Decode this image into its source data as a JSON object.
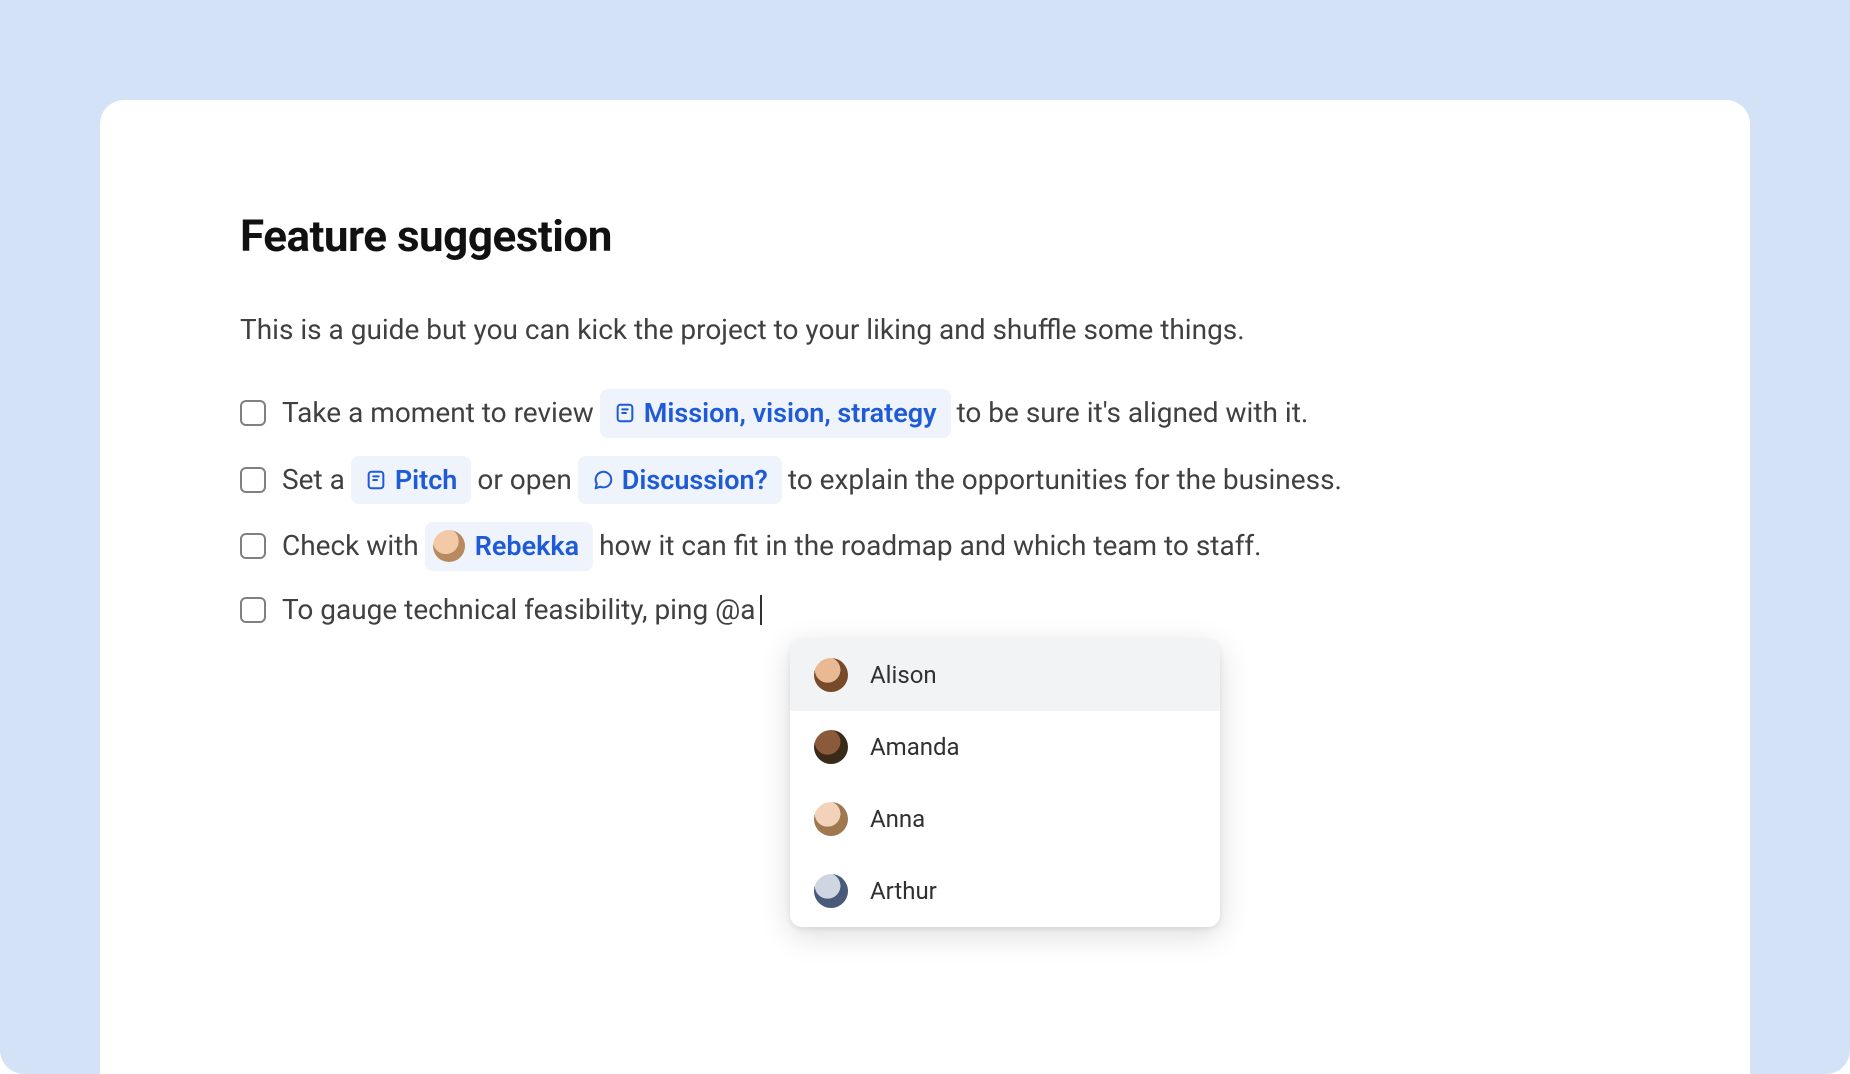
{
  "title": "Feature suggestion",
  "intro": "This is a guide but you can kick the project to your liking and shuffle some things.",
  "tasks": [
    {
      "pre": "Take a moment to review",
      "tag1": "Mission, vision, strategy",
      "post": "to be sure it's aligned with it."
    },
    {
      "pre": "Set a",
      "tag1": "Pitch",
      "mid": "or open",
      "tag2": "Discussion?",
      "post": "to explain the opportunities for the business."
    },
    {
      "pre": "Check with",
      "mention": "Rebekka",
      "post": "how it can fit in the roadmap and which team to staff."
    },
    {
      "pre": "To gauge technical feasibility, ping @a"
    }
  ],
  "mention_popup": {
    "items": [
      {
        "name": "Alison"
      },
      {
        "name": "Amanda"
      },
      {
        "name": "Anna"
      },
      {
        "name": "Arthur"
      }
    ],
    "selected_index": 0
  },
  "colors": {
    "background_blue": "#d4e2f7",
    "link_blue": "#1f5bd6",
    "tag_bg": "#eef3fc"
  }
}
